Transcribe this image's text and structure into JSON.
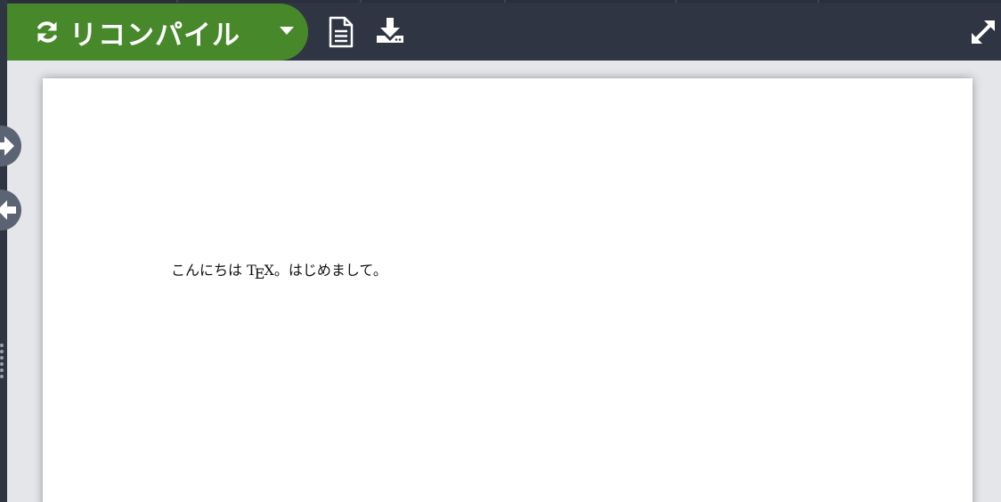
{
  "toolbar": {
    "recompile_label": "リコンパイル",
    "icons": {
      "recompile": "refresh-icon",
      "dropdown": "caret-down-icon",
      "logs": "document-icon",
      "download": "download-icon",
      "expand": "expand-icon"
    }
  },
  "side_controls": {
    "icons": [
      "arrow-right-icon",
      "arrow-left-icon",
      "drag-grip-icon"
    ]
  },
  "pdf": {
    "text_before": "こんにちは ",
    "tex_t": "T",
    "tex_e": "E",
    "tex_x": "X",
    "text_after": "。はじめまして。"
  },
  "colors": {
    "toolbar_bg": "#2f3542",
    "recompile_bg": "#46882a",
    "pane_bg": "#e4e6ea",
    "page_bg": "#ffffff"
  }
}
